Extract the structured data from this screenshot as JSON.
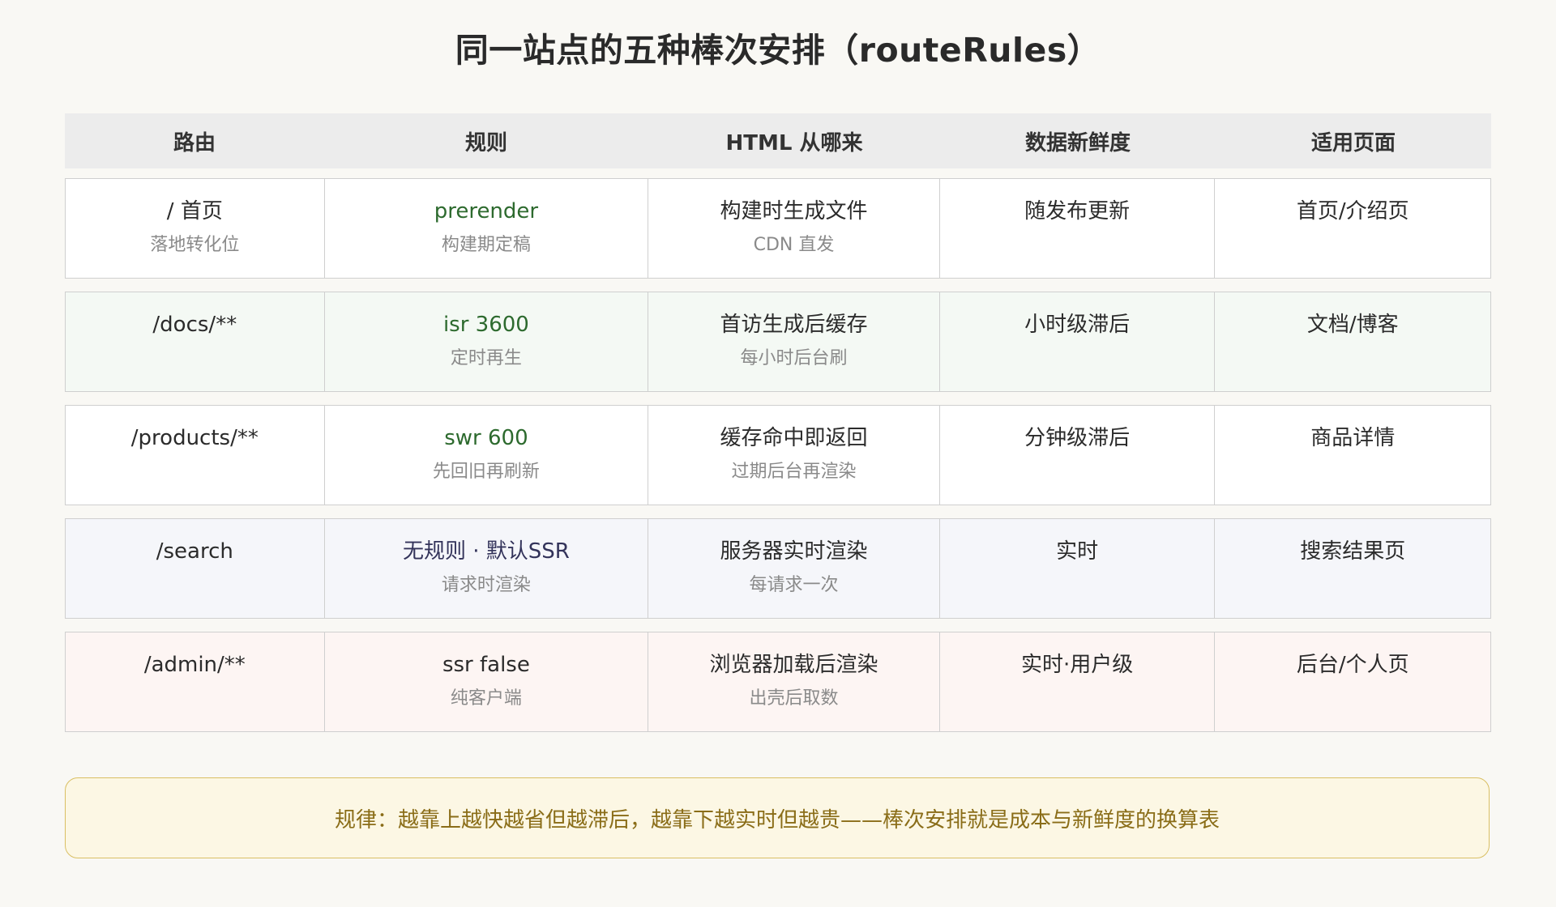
{
  "title": "同一站点的五种棒次安排（routeRules）",
  "headers": [
    "路由",
    "规则",
    "HTML 从哪来",
    "数据新鲜度",
    "适用页面"
  ],
  "rows": [
    {
      "route": "/ 首页",
      "route_sub": "落地转化位",
      "rule": "prerender",
      "rule_sub": "构建期定稿",
      "source": "构建时生成文件",
      "source_sub": "CDN 直发",
      "freshness": "随发布更新",
      "pages": "首页/介绍页"
    },
    {
      "route": "/docs/**",
      "route_sub": "",
      "rule": "isr 3600",
      "rule_sub": "定时再生",
      "source": "首访生成后缓存",
      "source_sub": "每小时后台刷",
      "freshness": "小时级滞后",
      "pages": "文档/博客"
    },
    {
      "route": "/products/**",
      "route_sub": "",
      "rule": "swr 600",
      "rule_sub": "先回旧再刷新",
      "source": "缓存命中即返回",
      "source_sub": "过期后台再渲染",
      "freshness": "分钟级滞后",
      "pages": "商品详情"
    },
    {
      "route": "/search",
      "route_sub": "",
      "rule": "无规则 · 默认SSR",
      "rule_sub": "请求时渲染",
      "source": "服务器实时渲染",
      "source_sub": "每请求一次",
      "freshness": "实时",
      "pages": "搜索结果页"
    },
    {
      "route": "/admin/**",
      "route_sub": "",
      "rule": "ssr false",
      "rule_sub": "纯客户端",
      "source": "浏览器加载后渲染",
      "source_sub": "出壳后取数",
      "freshness": "实时·用户级",
      "pages": "后台/个人页"
    }
  ],
  "note": "规律：越靠上越快越省但越滞后，越靠下越实时但越贵——棒次安排就是成本与新鲜度的换算表",
  "colors": {
    "background": "#f9f8f4",
    "header_bg": "#ececec",
    "rule_green": "#2d6a2e",
    "rule_navy": "#33335a",
    "note_bg": "#fcf7e4",
    "note_border": "#d9bf63",
    "note_text": "#8a6d18"
  }
}
